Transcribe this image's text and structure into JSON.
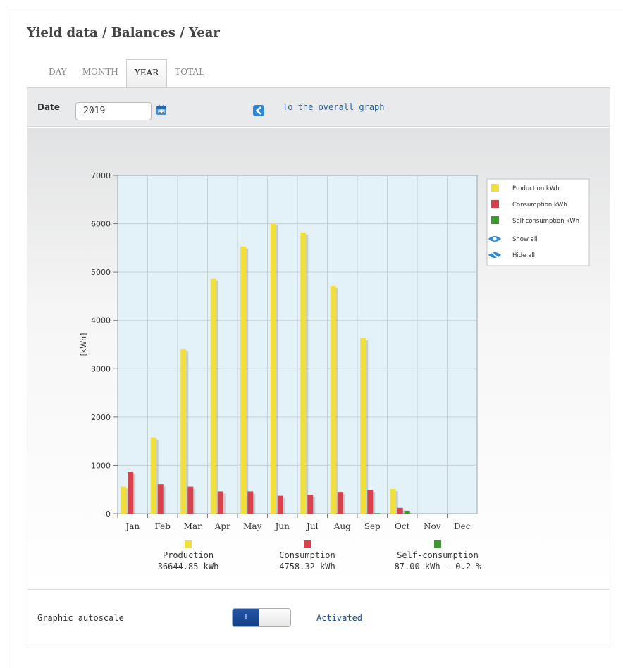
{
  "page": {
    "title": "Yield data / Balances / Year"
  },
  "tabs": [
    {
      "label": "DAY",
      "active": false
    },
    {
      "label": "MONTH",
      "active": false
    },
    {
      "label": "YEAR",
      "active": true
    },
    {
      "label": "TOTAL",
      "active": false
    }
  ],
  "toolbar": {
    "date_label": "Date",
    "date_value": "2019",
    "overall_link": "To the overall graph",
    "calendar_icon": "calendar-icon",
    "back_icon": "back-arrow-icon"
  },
  "colors": {
    "production": "#f2e03a",
    "consumption": "#d9414b",
    "self_consumption": "#3a9a2e",
    "plot_bg": "#e3f1f8",
    "link": "#1a5fb4"
  },
  "chart_data": {
    "type": "bar",
    "categories": [
      "Jan",
      "Feb",
      "Mar",
      "Apr",
      "May",
      "Jun",
      "Jul",
      "Aug",
      "Sep",
      "Oct",
      "Nov",
      "Dec"
    ],
    "series": [
      {
        "name": "Production kWh",
        "values": [
          560,
          1580,
          3410,
          4860,
          5530,
          6010,
          5820,
          4710,
          3630,
          510,
          0,
          0
        ]
      },
      {
        "name": "Consumption kWh",
        "values": [
          860,
          610,
          560,
          460,
          460,
          370,
          390,
          450,
          490,
          120,
          0,
          0
        ]
      },
      {
        "name": "Self-consumption kWh",
        "values": [
          0,
          0,
          0,
          0,
          0,
          0,
          0,
          0,
          10,
          60,
          0,
          0
        ]
      }
    ],
    "ylabel": "[kWh]",
    "ylim": [
      0,
      7000
    ],
    "yticks": [
      0,
      1000,
      2000,
      3000,
      4000,
      5000,
      6000,
      7000
    ],
    "grid": true,
    "legend_position": "right",
    "legend_extra": [
      "Show all",
      "Hide all"
    ]
  },
  "summary": [
    {
      "label": "Production",
      "value": "36644.85 kWh"
    },
    {
      "label": "Consumption",
      "value": "4758.32 kWh"
    },
    {
      "label": "Self-consumption",
      "value": "87.00 kWh – 0.2 %"
    }
  ],
  "autoscale": {
    "label": "Graphic autoscale",
    "toggle_on_text": "I",
    "status": "Activated"
  }
}
